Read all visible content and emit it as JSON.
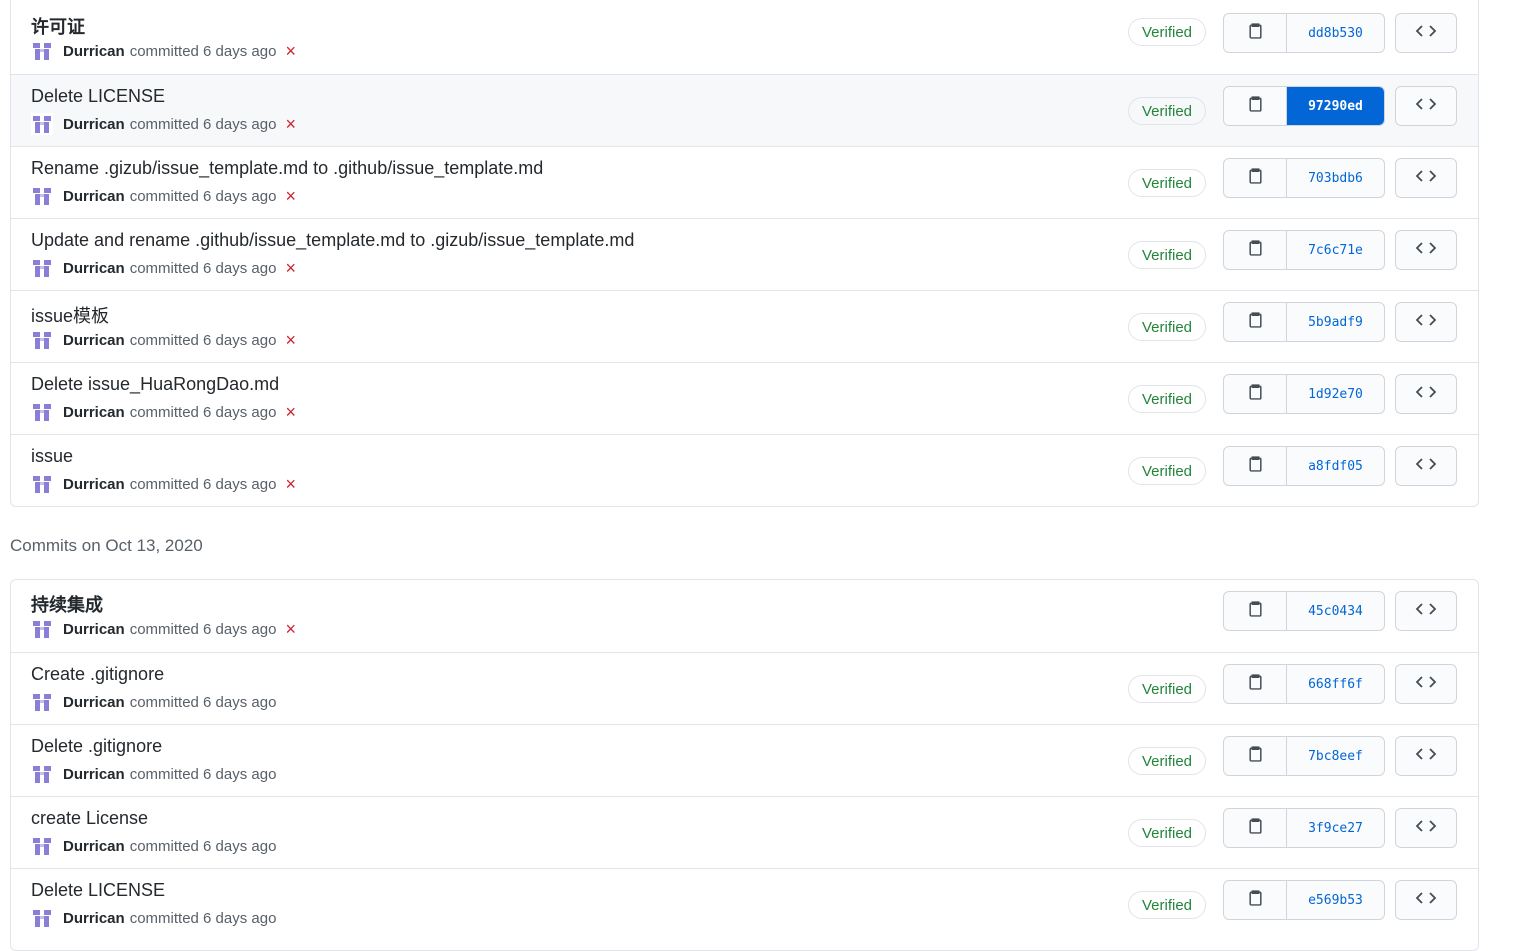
{
  "groups": [
    {
      "heading": "",
      "commits": [
        {
          "title": "许可证",
          "bold": true,
          "author": "Durrican",
          "time": "committed 6 days ago",
          "failed": true,
          "verified": "Verified",
          "sha": "dd8b530",
          "active": false
        },
        {
          "title": "Delete LICENSE",
          "bold": false,
          "author": "Durrican",
          "time": "committed 6 days ago",
          "failed": true,
          "verified": "Verified",
          "sha": "97290ed",
          "active": true
        },
        {
          "title": "Rename .gizub/issue_template.md to .github/issue_template.md",
          "bold": false,
          "author": "Durrican",
          "time": "committed 6 days ago",
          "failed": true,
          "verified": "Verified",
          "sha": "703bdb6",
          "active": false
        },
        {
          "title": "Update and rename .github/issue_template.md to .gizub/issue_template.md",
          "bold": false,
          "author": "Durrican",
          "time": "committed 6 days ago",
          "failed": true,
          "verified": "Verified",
          "sha": "7c6c71e",
          "active": false
        },
        {
          "title": "issue模板",
          "bold": false,
          "author": "Durrican",
          "time": "committed 6 days ago",
          "failed": true,
          "verified": "Verified",
          "sha": "5b9adf9",
          "active": false
        },
        {
          "title": "Delete issue_HuaRongDao.md",
          "bold": false,
          "author": "Durrican",
          "time": "committed 6 days ago",
          "failed": true,
          "verified": "Verified",
          "sha": "1d92e70",
          "active": false
        },
        {
          "title": "issue",
          "bold": false,
          "author": "Durrican",
          "time": "committed 6 days ago",
          "failed": true,
          "verified": "Verified",
          "sha": "a8fdf05",
          "active": false
        }
      ]
    },
    {
      "heading": "Commits on Oct 13, 2020",
      "commits": [
        {
          "title": "持续集成",
          "bold": true,
          "author": "Durrican",
          "time": "committed 6 days ago",
          "failed": true,
          "verified": "",
          "sha": "45c0434",
          "active": false
        },
        {
          "title": "Create .gitignore",
          "bold": false,
          "author": "Durrican",
          "time": "committed 6 days ago",
          "failed": false,
          "verified": "Verified",
          "sha": "668ff6f",
          "active": false
        },
        {
          "title": "Delete .gitignore",
          "bold": false,
          "author": "Durrican",
          "time": "committed 6 days ago",
          "failed": false,
          "verified": "Verified",
          "sha": "7bc8eef",
          "active": false
        },
        {
          "title": "create License",
          "bold": false,
          "author": "Durrican",
          "time": "committed 6 days ago",
          "failed": false,
          "verified": "Verified",
          "sha": "3f9ce27",
          "active": false
        },
        {
          "title": "Delete LICENSE",
          "bold": false,
          "author": "Durrican",
          "time": "committed 6 days ago",
          "failed": false,
          "verified": "Verified",
          "sha": "e569b53",
          "active": false
        }
      ]
    }
  ],
  "icons": {
    "status_failed": "×",
    "copy": "clipboard-icon",
    "browse": "code-icon"
  },
  "colors": {
    "link": "#0366d6",
    "verified": "#22863a",
    "failed": "#cb2431"
  }
}
